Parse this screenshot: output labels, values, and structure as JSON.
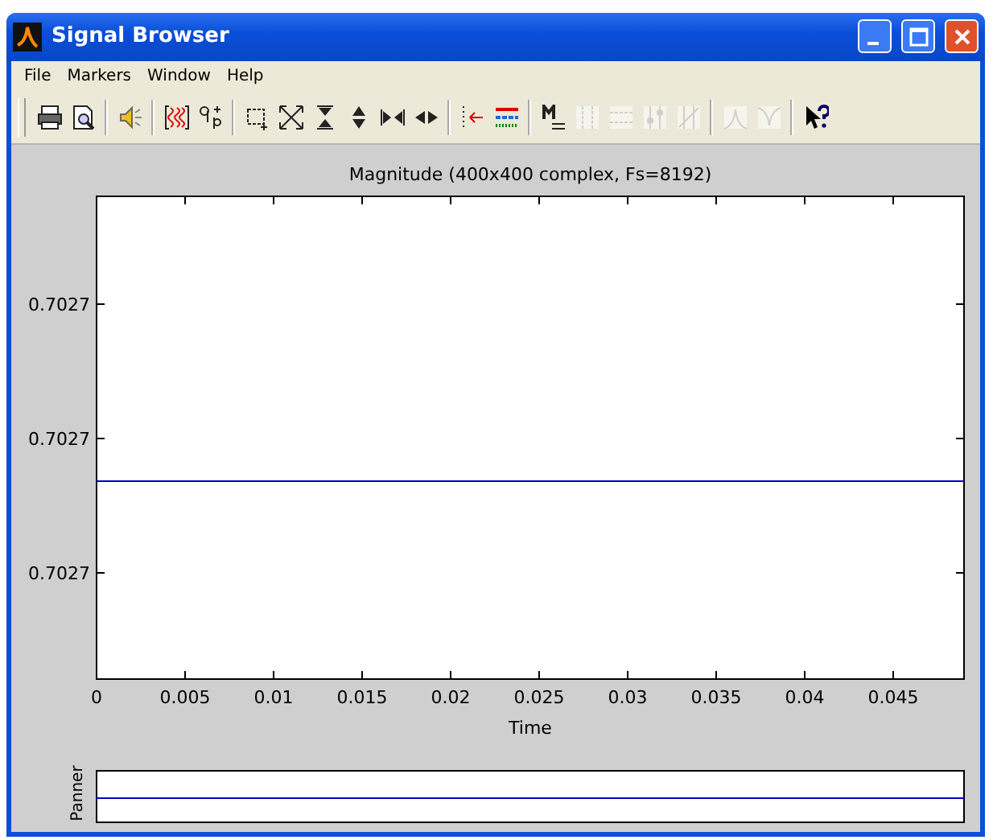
{
  "window": {
    "title": "Signal Browser"
  },
  "menu": [
    "File",
    "Markers",
    "Window",
    "Help"
  ],
  "toolbar": [
    [
      {
        "kind": "print",
        "disabled": false
      },
      {
        "kind": "preview",
        "disabled": false
      }
    ],
    [
      {
        "kind": "speaker",
        "disabled": false
      }
    ],
    [
      {
        "kind": "select",
        "disabled": false
      },
      {
        "kind": "array",
        "disabled": false
      }
    ],
    [
      {
        "kind": "zoombox",
        "disabled": false
      },
      {
        "kind": "full",
        "disabled": false
      },
      {
        "kind": "yin",
        "disabled": false
      },
      {
        "kind": "yout",
        "disabled": false
      },
      {
        "kind": "xin",
        "disabled": false
      },
      {
        "kind": "xout",
        "disabled": false
      }
    ],
    [
      {
        "kind": "marker",
        "disabled": false
      },
      {
        "kind": "lineprops",
        "disabled": false
      }
    ],
    [
      {
        "kind": "mtoggle",
        "disabled": false
      },
      {
        "kind": "vmark",
        "disabled": true
      },
      {
        "kind": "hmark",
        "disabled": true
      },
      {
        "kind": "track",
        "disabled": true
      },
      {
        "kind": "slope",
        "disabled": true
      }
    ],
    [
      {
        "kind": "peak",
        "disabled": true
      },
      {
        "kind": "valley",
        "disabled": true
      }
    ],
    [
      {
        "kind": "help",
        "disabled": false
      }
    ]
  ],
  "plot": {
    "title": "Magnitude (400x400 complex, Fs=8192)",
    "y_tick_labels": [
      "0.7027",
      "0.7027",
      "0.7027"
    ],
    "x_tick_labels": [
      "0",
      "0.005",
      "0.01",
      "0.015",
      "0.02",
      "0.025",
      "0.03",
      "0.035",
      "0.04",
      "0.045"
    ],
    "xlabel": "Time"
  },
  "panner": {
    "label": "Panner"
  }
}
